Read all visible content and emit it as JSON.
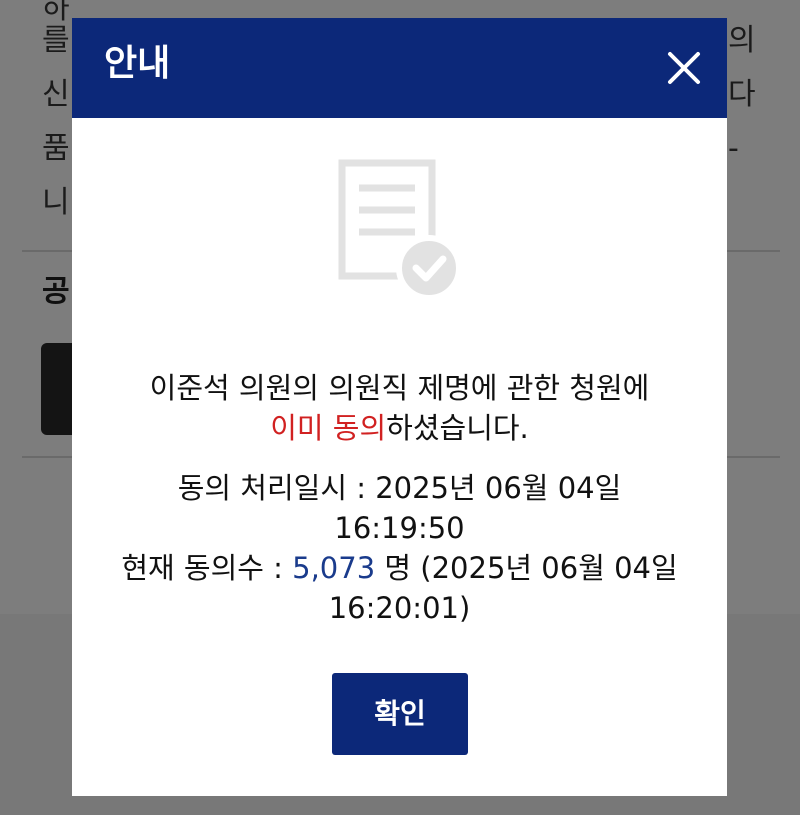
{
  "background": {
    "lines": [
      "하",
      "를",
      "신",
      "품",
      "니"
    ],
    "right_glyphs": [
      "의",
      "다",
      "-"
    ],
    "section_heading": "공"
  },
  "modal": {
    "title": "안내",
    "close_icon": "close-icon",
    "doc_icon": "document-check-icon",
    "message_line1": "이준석 의원의 의원직 제명에 관한 청원에",
    "message_highlight": "이미 동의",
    "message_line2_suffix": "하셨습니다.",
    "process_label": "동의 처리일시 : 2025년 06월 04일",
    "process_time": "16:19:50",
    "count_label": "현재 동의수 : ",
    "count_value": "5,073",
    "count_suffix": " 명 (2025년 06월 04일",
    "count_time": "16:20:01)",
    "confirm_label": "확인"
  },
  "colors": {
    "header": "#0c2879",
    "highlight_red": "#d12121",
    "count_blue": "#1a3b8c",
    "overlay": "#7d7d7d"
  }
}
